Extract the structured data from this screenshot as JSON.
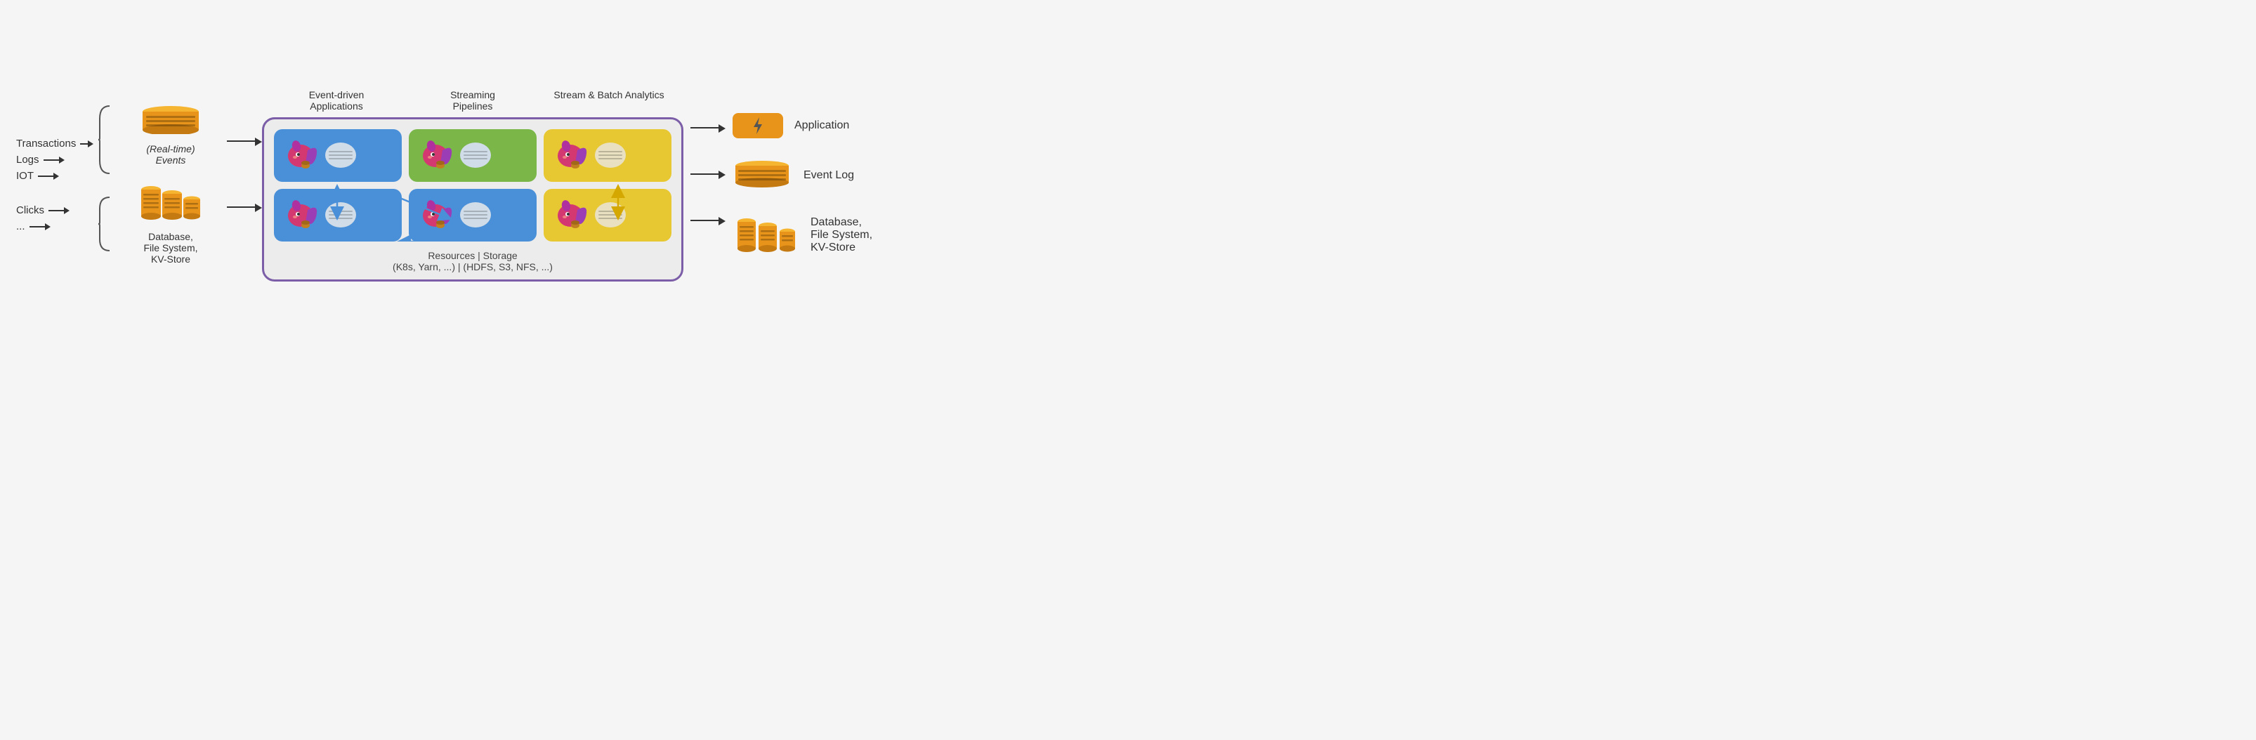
{
  "sources": {
    "items": [
      {
        "label": "Transactions"
      },
      {
        "label": "Logs"
      },
      {
        "label": "IOT"
      },
      {
        "label": "Clicks"
      },
      {
        "label": "..."
      }
    ]
  },
  "events": {
    "top_label": "(Real-time)\nEvents",
    "bottom_label": "Database,\nFile System,\nKV-Store"
  },
  "column_headers": {
    "col1": "Event-driven\nApplications",
    "col2": "Streaming\nPipelines",
    "col3": "Stream & Batch\nAnalytics"
  },
  "main_box": {
    "footer": "Resources | Storage\n(K8s, Yarn, ...) | (HDFS, S3, NFS, ...)"
  },
  "outputs": {
    "items": [
      {
        "label": "Application"
      },
      {
        "label": "Event Log"
      },
      {
        "label": "Database,\nFile System,\nKV-Store"
      }
    ]
  }
}
